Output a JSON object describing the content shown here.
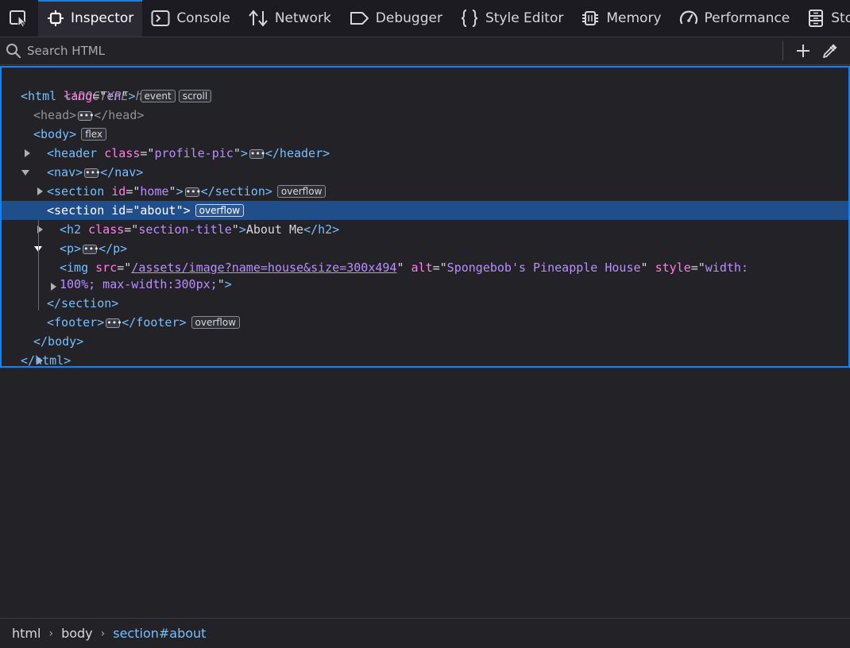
{
  "toolbar": {
    "tabs": [
      {
        "label": "Inspector",
        "icon": "inspector-icon",
        "active": true
      },
      {
        "label": "Console",
        "icon": "console-icon",
        "active": false
      },
      {
        "label": "Network",
        "icon": "network-icon",
        "active": false
      },
      {
        "label": "Debugger",
        "icon": "debugger-icon",
        "active": false
      },
      {
        "label": "Style Editor",
        "icon": "style-editor-icon",
        "active": false
      },
      {
        "label": "Memory",
        "icon": "memory-icon",
        "active": false
      },
      {
        "label": "Performance",
        "icon": "performance-icon",
        "active": false
      },
      {
        "label": "Sto",
        "icon": "storage-icon",
        "active": false
      }
    ]
  },
  "search": {
    "placeholder": "Search HTML"
  },
  "markup": {
    "doctype": "<!DOCTYPE html>",
    "html_open": {
      "tag": "html",
      "attr": "lang",
      "value": "en",
      "badges": [
        "event",
        "scroll"
      ]
    },
    "head": {
      "open": "<head>",
      "close": "</head>"
    },
    "body_open": {
      "tag": "body",
      "badges": [
        "flex"
      ]
    },
    "header": {
      "tag": "header",
      "attr": "class",
      "value": "profile-pic",
      "close": "</header>"
    },
    "nav": {
      "tag": "nav",
      "close": "</nav>"
    },
    "section_home": {
      "tag": "section",
      "attr": "id",
      "value": "home",
      "close": "</section>",
      "badges": [
        "overflow"
      ]
    },
    "section_about": {
      "tag": "section",
      "attr": "id",
      "value": "about",
      "badges": [
        "overflow"
      ]
    },
    "h2": {
      "tag": "h2",
      "attr": "class",
      "value": "section-title",
      "text": "About Me",
      "close": "</h2>"
    },
    "p": {
      "tag": "p",
      "close": "</p>"
    },
    "img": {
      "tag": "img",
      "src_attr": "src",
      "src_value": "/assets/image?name=house&size=300x494",
      "alt_attr": "alt",
      "alt_value": "Spongebob's Pineapple House",
      "style_attr": "style",
      "style_value_1": "width:",
      "style_value_2": "100%; max-width:300px;"
    },
    "section_close": "</section>",
    "footer": {
      "tag": "footer",
      "close": "</footer>",
      "badges": [
        "overflow"
      ]
    },
    "body_close": "</body>",
    "html_close": "</html>"
  },
  "breadcrumb": {
    "items": [
      "html",
      "body",
      "section#about"
    ],
    "separator": "›"
  },
  "colors": {
    "tag": "#75bfff",
    "attribute": "#ff7de9",
    "value": "#b98eff",
    "selection": "#204e8a",
    "accent": "#0a84ff"
  }
}
